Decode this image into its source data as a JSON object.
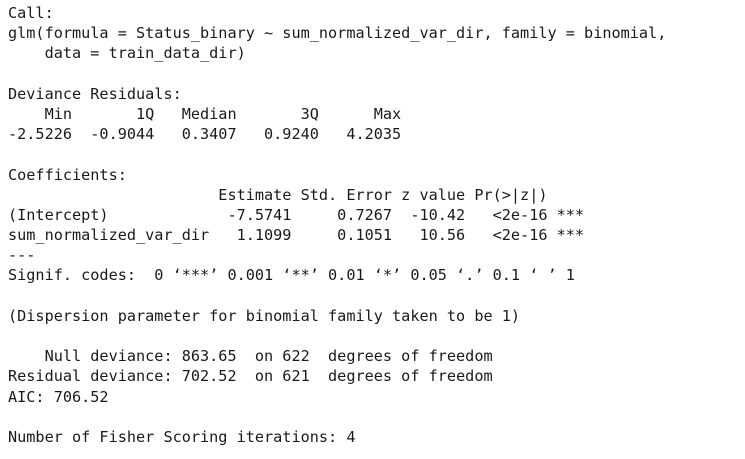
{
  "console": {
    "lines": [
      "Call:",
      "glm(formula = Status_binary ~ sum_normalized_var_dir, family = binomial,",
      "    data = train_data_dir)",
      "",
      "Deviance Residuals: ",
      "    Min       1Q   Median       3Q      Max  ",
      "-2.5226  -0.9044   0.3407   0.9240   4.2035  ",
      "",
      "Coefficients:",
      "                       Estimate Std. Error z value Pr(>|z|)    ",
      "(Intercept)             -7.5741     0.7267  -10.42   <2e-16 ***",
      "sum_normalized_var_dir   1.1099     0.1051   10.56   <2e-16 ***",
      "---",
      "Signif. codes:  0 ‘***’ 0.001 ‘**’ 0.01 ‘*’ 0.05 ‘.’ 0.1 ‘ ’ 1",
      "",
      "(Dispersion parameter for binomial family taken to be 1)",
      "",
      "    Null deviance: 863.65  on 622  degrees of freedom",
      "Residual deviance: 702.52  on 621  degrees of freedom",
      "AIC: 706.52",
      "",
      "Number of Fisher Scoring iterations: 4"
    ]
  }
}
